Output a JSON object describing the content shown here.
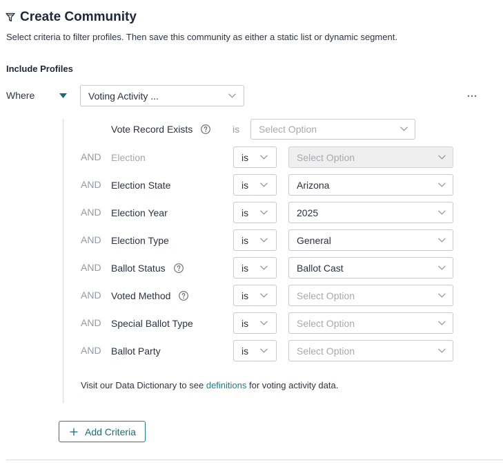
{
  "header": {
    "title": "Create Community",
    "description": "Select criteria to filter profiles. Then save this community as either a static list or dynamic segment."
  },
  "include": {
    "heading": "Include Profiles",
    "where_label": "Where",
    "source_value": "Voting Activity ..."
  },
  "criteria": {
    "first": {
      "label": "Vote Record Exists",
      "icon": "help-icon",
      "operator": "is",
      "placeholder": "Select Option"
    },
    "rows": [
      {
        "conjunction": "AND",
        "label": "Election",
        "operator": "is",
        "placeholder": "Select Option",
        "value_disabled": true
      },
      {
        "conjunction": "AND",
        "label": "Election State",
        "operator": "is",
        "value": "Arizona"
      },
      {
        "conjunction": "AND",
        "label": "Election Year",
        "operator": "is",
        "value": "2025"
      },
      {
        "conjunction": "AND",
        "label": "Election Type",
        "operator": "is",
        "value": "General"
      },
      {
        "conjunction": "AND",
        "label": "Ballot Status",
        "icon": "help-icon",
        "operator": "is",
        "value": "Ballot Cast"
      },
      {
        "conjunction": "AND",
        "label": "Voted Method",
        "icon": "help-icon",
        "operator": "is",
        "placeholder": "Select Option"
      },
      {
        "conjunction": "AND",
        "label": "Special Ballot Type",
        "operator": "is",
        "placeholder": "Select Option"
      },
      {
        "conjunction": "AND",
        "label": "Ballot Party",
        "operator": "is",
        "placeholder": "Select Option"
      }
    ]
  },
  "note": {
    "prefix": "Visit our Data Dictionary to see ",
    "link": "definitions",
    "suffix": " for voting activity data."
  },
  "add_criteria": {
    "label": "Add Criteria"
  },
  "icons": {
    "title": "funnel-icon",
    "group_toggle": "caret-down-icon",
    "select": "chevron-down-icon",
    "help": "help-icon",
    "more": "more-options-icon",
    "add": "plus-icon"
  },
  "colors": {
    "accent": "#16737d",
    "text": "#232b3a",
    "muted_text": "#969ca4",
    "border": "#c6c9ce",
    "disabled_bg": "#efefef"
  }
}
